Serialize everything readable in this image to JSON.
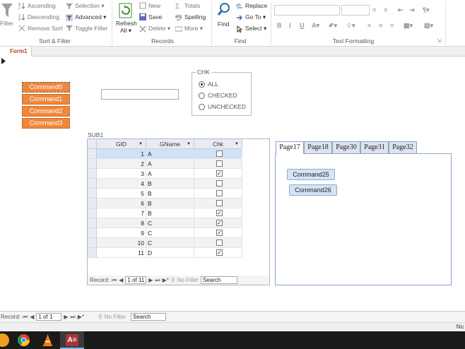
{
  "ribbon": {
    "sort_filter": {
      "filter": "Filter",
      "ascending": "Ascending",
      "descending": "Descending",
      "remove_sort": "Remove Sort",
      "selection": "Selection ▾",
      "advanced": "Advanced ▾",
      "toggle_filter": "Toggle Filter",
      "group_label": "Sort & Filter"
    },
    "records": {
      "refresh": "Refresh",
      "refresh_sub": "All ▾",
      "new": "New",
      "save": "Save",
      "delete": "Delete ▾",
      "totals": "Totals",
      "spelling": "Spelling",
      "more": "More ▾",
      "group_label": "Records"
    },
    "find": {
      "find": "Find",
      "replace": "Replace",
      "goto": "Go To ▾",
      "select": "Select ▾",
      "group_label": "Find"
    },
    "text_formatting": {
      "bold": "B",
      "italic": "I",
      "underline": "U",
      "group_label": "Text Formatting"
    }
  },
  "doc_tab": {
    "label": "Form1"
  },
  "form": {
    "buttons": [
      "Command0",
      "Command1",
      "Command2",
      "Command3"
    ],
    "textbox_value": "",
    "option_group": {
      "caption": "CHK",
      "options": [
        "ALL",
        "CHECKED",
        "UNCHECKED"
      ],
      "selected": "ALL"
    },
    "subform_label": "SUB1",
    "grid": {
      "columns": [
        "GID",
        "GName",
        "Chk"
      ],
      "rows": [
        {
          "gid": "1",
          "gname": "A",
          "chk": false
        },
        {
          "gid": "2",
          "gname": "A",
          "chk": false
        },
        {
          "gid": "3",
          "gname": "A",
          "chk": true
        },
        {
          "gid": "4",
          "gname": "B",
          "chk": false
        },
        {
          "gid": "5",
          "gname": "B",
          "chk": false
        },
        {
          "gid": "6",
          "gname": "B",
          "chk": false
        },
        {
          "gid": "7",
          "gname": "B",
          "chk": true
        },
        {
          "gid": "8",
          "gname": "C",
          "chk": true
        },
        {
          "gid": "9",
          "gname": "C",
          "chk": true
        },
        {
          "gid": "10",
          "gname": "C",
          "chk": false
        },
        {
          "gid": "11",
          "gname": "D",
          "chk": true
        }
      ]
    },
    "sub_nav": {
      "record_label": "Record:",
      "position": "1 of 11",
      "no_filter": "No Filter",
      "search": "Search"
    },
    "tabs": [
      "Page17",
      "Page18",
      "Page30",
      "Page31",
      "Page32"
    ],
    "active_tab": "Page17",
    "tab_buttons": [
      "Command25",
      "Command26"
    ]
  },
  "bottom_nav": {
    "record_label": "Record:",
    "position": "1 of 1",
    "no_filter": "No Filter",
    "search": "Search"
  },
  "status": {
    "right_text": "Nu"
  },
  "colors": {
    "command_button": "#f0873c",
    "accent_blue": "#8aa4c8",
    "selected_row": "#cfe2f7",
    "doc_tab_text": "#c0392b"
  }
}
